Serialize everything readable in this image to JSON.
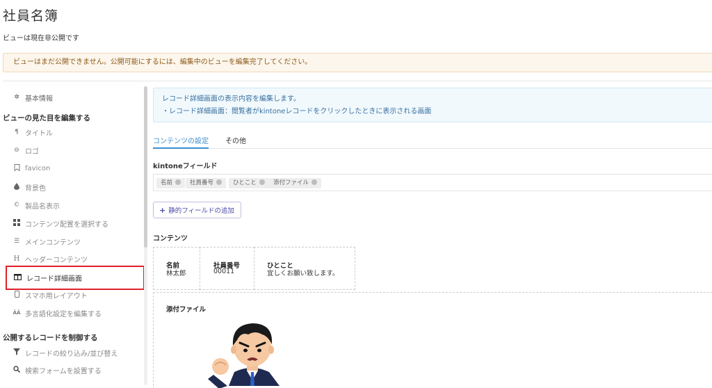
{
  "header": {
    "title": "社員名簿",
    "view_status": "ビューは現在非公開です",
    "warning": "ビューはまだ公開できません。公開可能にするには、編集中のビューを編集完了してください。"
  },
  "sidebar": {
    "basic_info": "基本情報",
    "section_appearance": "ビューの見た目を編集する",
    "items": [
      {
        "label": "タイトル",
        "icon": "paragraph-icon"
      },
      {
        "label": "ロゴ",
        "icon": "eye-icon"
      },
      {
        "label": "favicon",
        "icon": "bookmark-icon"
      },
      {
        "label": "背景色",
        "icon": "droplet-icon"
      },
      {
        "label": "製品名表示",
        "icon": "copyright-icon"
      },
      {
        "label": "コンテンツ配置を選択する",
        "icon": "grid-icon"
      },
      {
        "label": "メインコンテンツ",
        "icon": "list-icon"
      },
      {
        "label": "ヘッダーコンテンツ",
        "icon": "heading-icon"
      },
      {
        "label": "レコード詳細画面",
        "icon": "columns-icon"
      },
      {
        "label": "スマホ用レイアウト",
        "icon": "mobile-icon"
      },
      {
        "label": "多言語化設定を編集する",
        "icon": "language-icon"
      }
    ],
    "section_records": "公開するレコードを制御する",
    "record_items": [
      {
        "label": "レコードの絞り込み/並び替え",
        "icon": "filter-icon"
      },
      {
        "label": "検索フォームを設置する",
        "icon": "search-icon"
      }
    ]
  },
  "main": {
    "info_line1": "レコード詳細画面の表示内容を編集します。",
    "info_line2": "・レコード詳細画面：閲覧者がkintoneレコードをクリックしたときに表示される画面",
    "tabs": [
      {
        "label": "コンテンツの設定"
      },
      {
        "label": "その他"
      }
    ],
    "kintone_fields_label": "kintoneフィールド",
    "fields": [
      "名前",
      "社員番号",
      "ひとこと",
      "添付ファイル"
    ],
    "add_static_field": "静的フィールドの追加",
    "contents_label": "コンテンツ",
    "content_cells": [
      {
        "title": "名前",
        "value": "林太郎"
      },
      {
        "title": "社員番号",
        "value": "00011"
      },
      {
        "title": "ひとこと",
        "value": "宜しくお願い致します。"
      }
    ],
    "attachment_label": "添付ファイル"
  },
  "colors": {
    "accent": "#3c8dce",
    "highlight": "#e0202a",
    "warning_bg": "#fdf6ec",
    "info_bg": "#f1f9fd"
  }
}
